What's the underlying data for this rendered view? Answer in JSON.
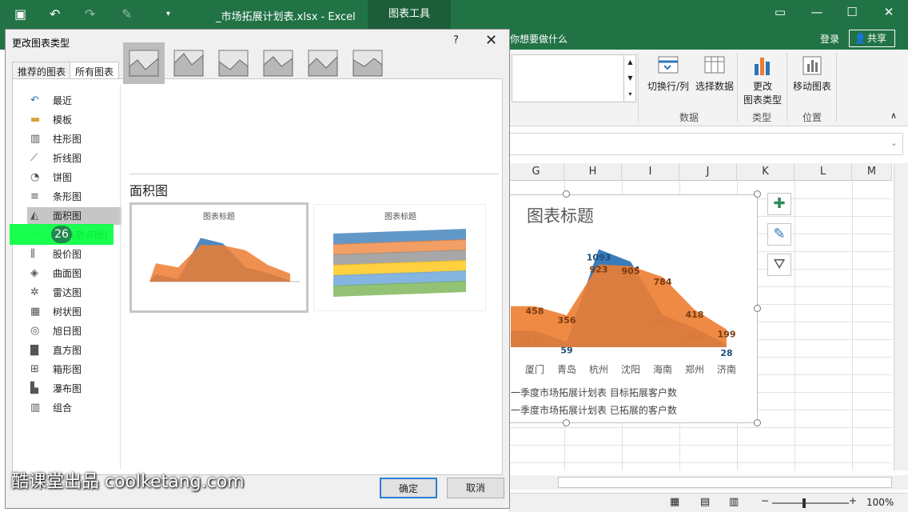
{
  "window": {
    "title": "_市场拓展计划表.xlsx - Excel",
    "context_tab": "图表工具"
  },
  "ribbon": {
    "tell_me": "你想要做什么",
    "login": "登录",
    "share": "共享",
    "buttons": {
      "switch_row_col": "切换行/列",
      "select_data": "选择数据",
      "change_chart_type_l1": "更改",
      "change_chart_type_l2": "图表类型",
      "move_chart": "移动图表"
    },
    "groups": {
      "data": "数据",
      "type": "类型",
      "location": "位置"
    }
  },
  "sheet": {
    "columns": [
      "G",
      "H",
      "I",
      "J",
      "K",
      "L",
      "M"
    ],
    "chart": {
      "title": "图表标题",
      "categories": [
        "厦门",
        "青岛",
        "杭州",
        "沈阳",
        "海南",
        "郑州",
        "济南"
      ],
      "legend": [
        "一季度市场拓展计划表 目标拓展客户数",
        "一季度市场拓展计划表 已拓展的客户数"
      ]
    }
  },
  "status": {
    "zoom": "100%"
  },
  "dialog": {
    "title": "更改图表类型",
    "help": "?",
    "tabs": [
      "推荐的图表",
      "所有图表"
    ],
    "categories": [
      "最近",
      "模板",
      "柱形图",
      "折线图",
      "饼图",
      "条形图",
      "面积图",
      "X Y (散点图)",
      "股价图",
      "曲面图",
      "雷达图",
      "树状图",
      "旭日图",
      "直方图",
      "箱形图",
      "瀑布图",
      "组合"
    ],
    "selected_category": "面积图",
    "section_title": "面积图",
    "preview_title_1": "图表标题",
    "preview_title_2": "图表标题",
    "ok": "确定",
    "cancel": "取消"
  },
  "overlay": {
    "badge": "26",
    "watermark": "酷课堂出品 coolketang.com"
  },
  "chart_data": {
    "type": "area",
    "title": "图表标题",
    "categories": [
      "厦门",
      "青岛",
      "杭州",
      "沈阳",
      "海南",
      "郑州",
      "济南"
    ],
    "series": [
      {
        "name": "一季度市场拓展计划表 目标拓展客户数",
        "values": [
          184,
          59,
          1093,
          954,
          360,
          218,
          28
        ]
      },
      {
        "name": "一季度市场拓展计划表 已拓展的客户数",
        "values": [
          458,
          356,
          923,
          905,
          784,
          418,
          199
        ]
      }
    ],
    "colors": [
      "#2e75b6",
      "#ed7d31"
    ]
  }
}
